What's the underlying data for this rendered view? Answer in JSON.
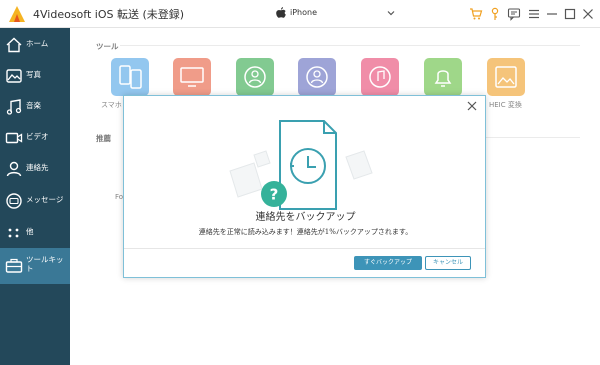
{
  "titlebar": {
    "app_title": "4Videosoft iOS 転送 (未登録)",
    "device": "iPhone",
    "icons": [
      "cart-icon",
      "key-icon",
      "feedback-icon",
      "menu-icon",
      "minimize-icon",
      "maximize-icon",
      "close-icon"
    ]
  },
  "sidebar": {
    "items": [
      {
        "label": "ホーム",
        "icon": "home-icon"
      },
      {
        "label": "写真",
        "icon": "photo-icon"
      },
      {
        "label": "音楽",
        "icon": "music-icon"
      },
      {
        "label": "ビデオ",
        "icon": "video-icon"
      },
      {
        "label": "連絡先",
        "icon": "contacts-icon"
      },
      {
        "label": "メッセージ",
        "icon": "message-icon"
      },
      {
        "label": "他",
        "icon": "other-icon"
      },
      {
        "label": "ツールキット",
        "icon": "toolkit-icon"
      }
    ],
    "active_index": 7
  },
  "main": {
    "tools_title": "ツール",
    "tools": [
      {
        "label": "スマホ",
        "icon": "phone-transfer-icon",
        "color": "#5aa9e6"
      },
      {
        "label": "",
        "icon": "device-to-pc-icon",
        "color": "#e8674a"
      },
      {
        "label": "",
        "icon": "backup-icon",
        "color": "#3fae56"
      },
      {
        "label": "",
        "icon": "restore-icon",
        "color": "#6a73c2"
      },
      {
        "label": "",
        "icon": "ringtone-icon",
        "color": "#e8507a"
      },
      {
        "label": "",
        "icon": "notification-icon",
        "color": "#6cc24a"
      },
      {
        "label": "HEIC 変換",
        "icon": "heic-icon",
        "color": "#f0a534"
      }
    ],
    "recommend_title": "推薦",
    "partial_item": "Fo"
  },
  "dialog": {
    "title": "連絡先をバックアップ",
    "message": "連絡先を正常に読み込みます！連絡先が1%バックアップされます。",
    "primary_button": "すぐバックアップ",
    "cancel_button": "キャンセル"
  },
  "colors": {
    "sidebar_bg": "#23485a",
    "sidebar_active": "#3a7896",
    "accent": "#3d94b8",
    "illustration_teal": "#3aa0b0"
  }
}
